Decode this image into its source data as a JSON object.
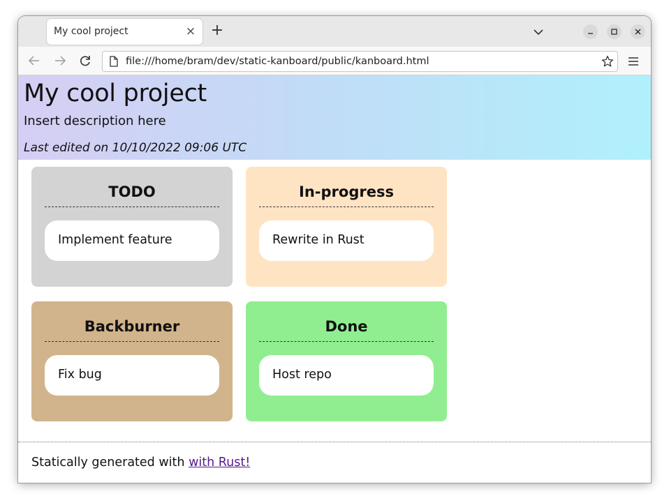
{
  "browser": {
    "tab_title": "My cool project",
    "tab_close": "×",
    "new_tab": "+",
    "url": "file:///home/bram/dev/static-kanboard/public/kanboard.html"
  },
  "page": {
    "title": "My cool project",
    "description": "Insert description here",
    "last_edited": "Last edited on 10/10/2022 09:06 UTC",
    "header_gradient": [
      "#d6cef4",
      "#b0f0fc"
    ]
  },
  "columns": [
    {
      "title": "TODO",
      "color": "#d3d3d3",
      "cards": [
        "Implement feature"
      ]
    },
    {
      "title": "In-progress",
      "color": "#ffe4c4",
      "cards": [
        "Rewrite in Rust"
      ]
    },
    {
      "title": "Backburner",
      "color": "#d2b48c",
      "cards": [
        "Fix bug"
      ]
    },
    {
      "title": "Done",
      "color": "#90ee90",
      "cards": [
        "Host repo"
      ]
    }
  ],
  "footer": {
    "text": "Statically generated with",
    "link_text": "with Rust!"
  },
  "icons": {
    "back": "arrow-left-icon",
    "forward": "arrow-right-icon",
    "reload": "reload-icon",
    "page": "file-icon",
    "bookmark": "star-icon",
    "menu": "hamburger-menu-icon",
    "tab_list": "chevron-down-icon"
  }
}
